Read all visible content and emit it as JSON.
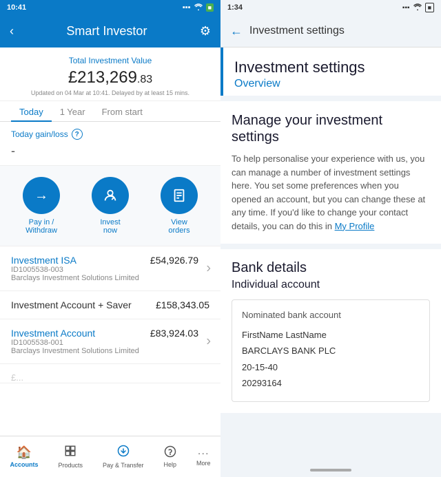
{
  "left": {
    "status_bar": {
      "time": "10:41",
      "wifi": "wifi",
      "battery": "battery"
    },
    "header": {
      "back_label": "‹",
      "title": "Smart Investor",
      "gear_label": "⚙"
    },
    "total_investment": {
      "label": "Total Investment Value",
      "value": "£213,269",
      "decimal": ".83",
      "updated": "Updated on 04 Mar at 10:41. Delayed by at least 15 mins."
    },
    "tabs": [
      {
        "label": "Today",
        "active": true
      },
      {
        "label": "1 Year",
        "active": false
      },
      {
        "label": "From start",
        "active": false
      }
    ],
    "gain_loss": {
      "label": "Today gain/loss",
      "value": "-"
    },
    "actions": [
      {
        "label": "Pay in /\nWithdraw",
        "icon": "→"
      },
      {
        "label": "Invest\nnow",
        "icon": "👤"
      },
      {
        "label": "View\norders",
        "icon": "📋"
      }
    ],
    "accounts": [
      {
        "name": "Investment ISA",
        "id": "ID1005538-003",
        "provider": "Barclays Investment Solutions Limited",
        "value": "£54,926.79",
        "chevron": true
      },
      {
        "name": "Investment Account + Saver",
        "id": "",
        "provider": "",
        "value": "£158,343.05",
        "chevron": false
      },
      {
        "name": "Investment Account",
        "id": "ID1005538-001",
        "provider": "Barclays Investment Solutions Limited",
        "value": "£83,924.03",
        "chevron": true
      }
    ],
    "bottom_nav": [
      {
        "icon": "🏠",
        "label": "Accounts",
        "active": true
      },
      {
        "icon": "📦",
        "label": "Products",
        "active": false
      },
      {
        "icon": "↔",
        "label": "Pay & Transfer",
        "active": false
      },
      {
        "icon": "?",
        "label": "Help",
        "active": false
      },
      {
        "icon": "···",
        "label": "More",
        "active": false
      }
    ]
  },
  "right": {
    "status_bar": {
      "time": "1:34",
      "wifi": "wifi",
      "battery": "battery"
    },
    "header": {
      "back_label": "←",
      "title": "Investment settings"
    },
    "settings_header": {
      "title": "Investment settings",
      "subtitle": "Overview"
    },
    "description": {
      "heading": "Manage your investment settings",
      "body": "To help personalise your experience with us, you can manage a number of investment settings here. You set some preferences when you opened an account, but you can change these at any time. If you'd like to change your contact details, you can do this in ",
      "link": "My Profile"
    },
    "bank_details": {
      "heading": "Bank details",
      "sub_heading": "Individual account",
      "card": {
        "label": "Nominated bank account",
        "name": "FirstName LastName",
        "bank": "BARCLAYS BANK PLC",
        "sort_code": "20-15-40",
        "account_number": "20293164"
      }
    }
  }
}
